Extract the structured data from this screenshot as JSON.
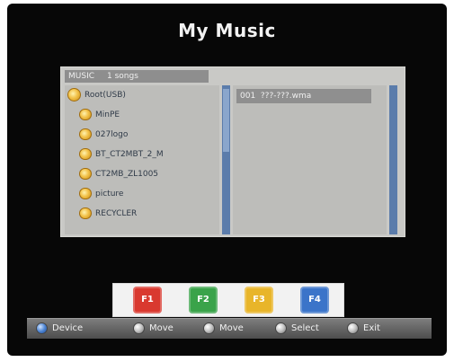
{
  "screen": {
    "title": "My Music"
  },
  "browser": {
    "header": {
      "label": "MUSIC",
      "count": "1 songs"
    },
    "folders": [
      {
        "label": "Root(USB)"
      },
      {
        "label": "MinPE"
      },
      {
        "label": "027logo"
      },
      {
        "label": "BT_CT2MBT_2_M"
      },
      {
        "label": "CT2MB_ZL1005"
      },
      {
        "label": "picture"
      },
      {
        "label": "RECYCLER"
      }
    ],
    "files": [
      {
        "label": "001  ???-???.wma"
      }
    ]
  },
  "function_keys": [
    {
      "label": "F1",
      "color": "#d9392f"
    },
    {
      "label": "F2",
      "color": "#3aa34a"
    },
    {
      "label": "F3",
      "color": "#e8b52a"
    },
    {
      "label": "F4",
      "color": "#3b74c9"
    }
  ],
  "hints": [
    {
      "label": "Device",
      "icon": "device-icon"
    },
    {
      "label": "Move",
      "icon": "up-down-icon"
    },
    {
      "label": "Move",
      "icon": "left-right-icon"
    },
    {
      "label": "Select",
      "icon": "ok-icon"
    },
    {
      "label": "Exit",
      "icon": "exit-icon"
    }
  ]
}
